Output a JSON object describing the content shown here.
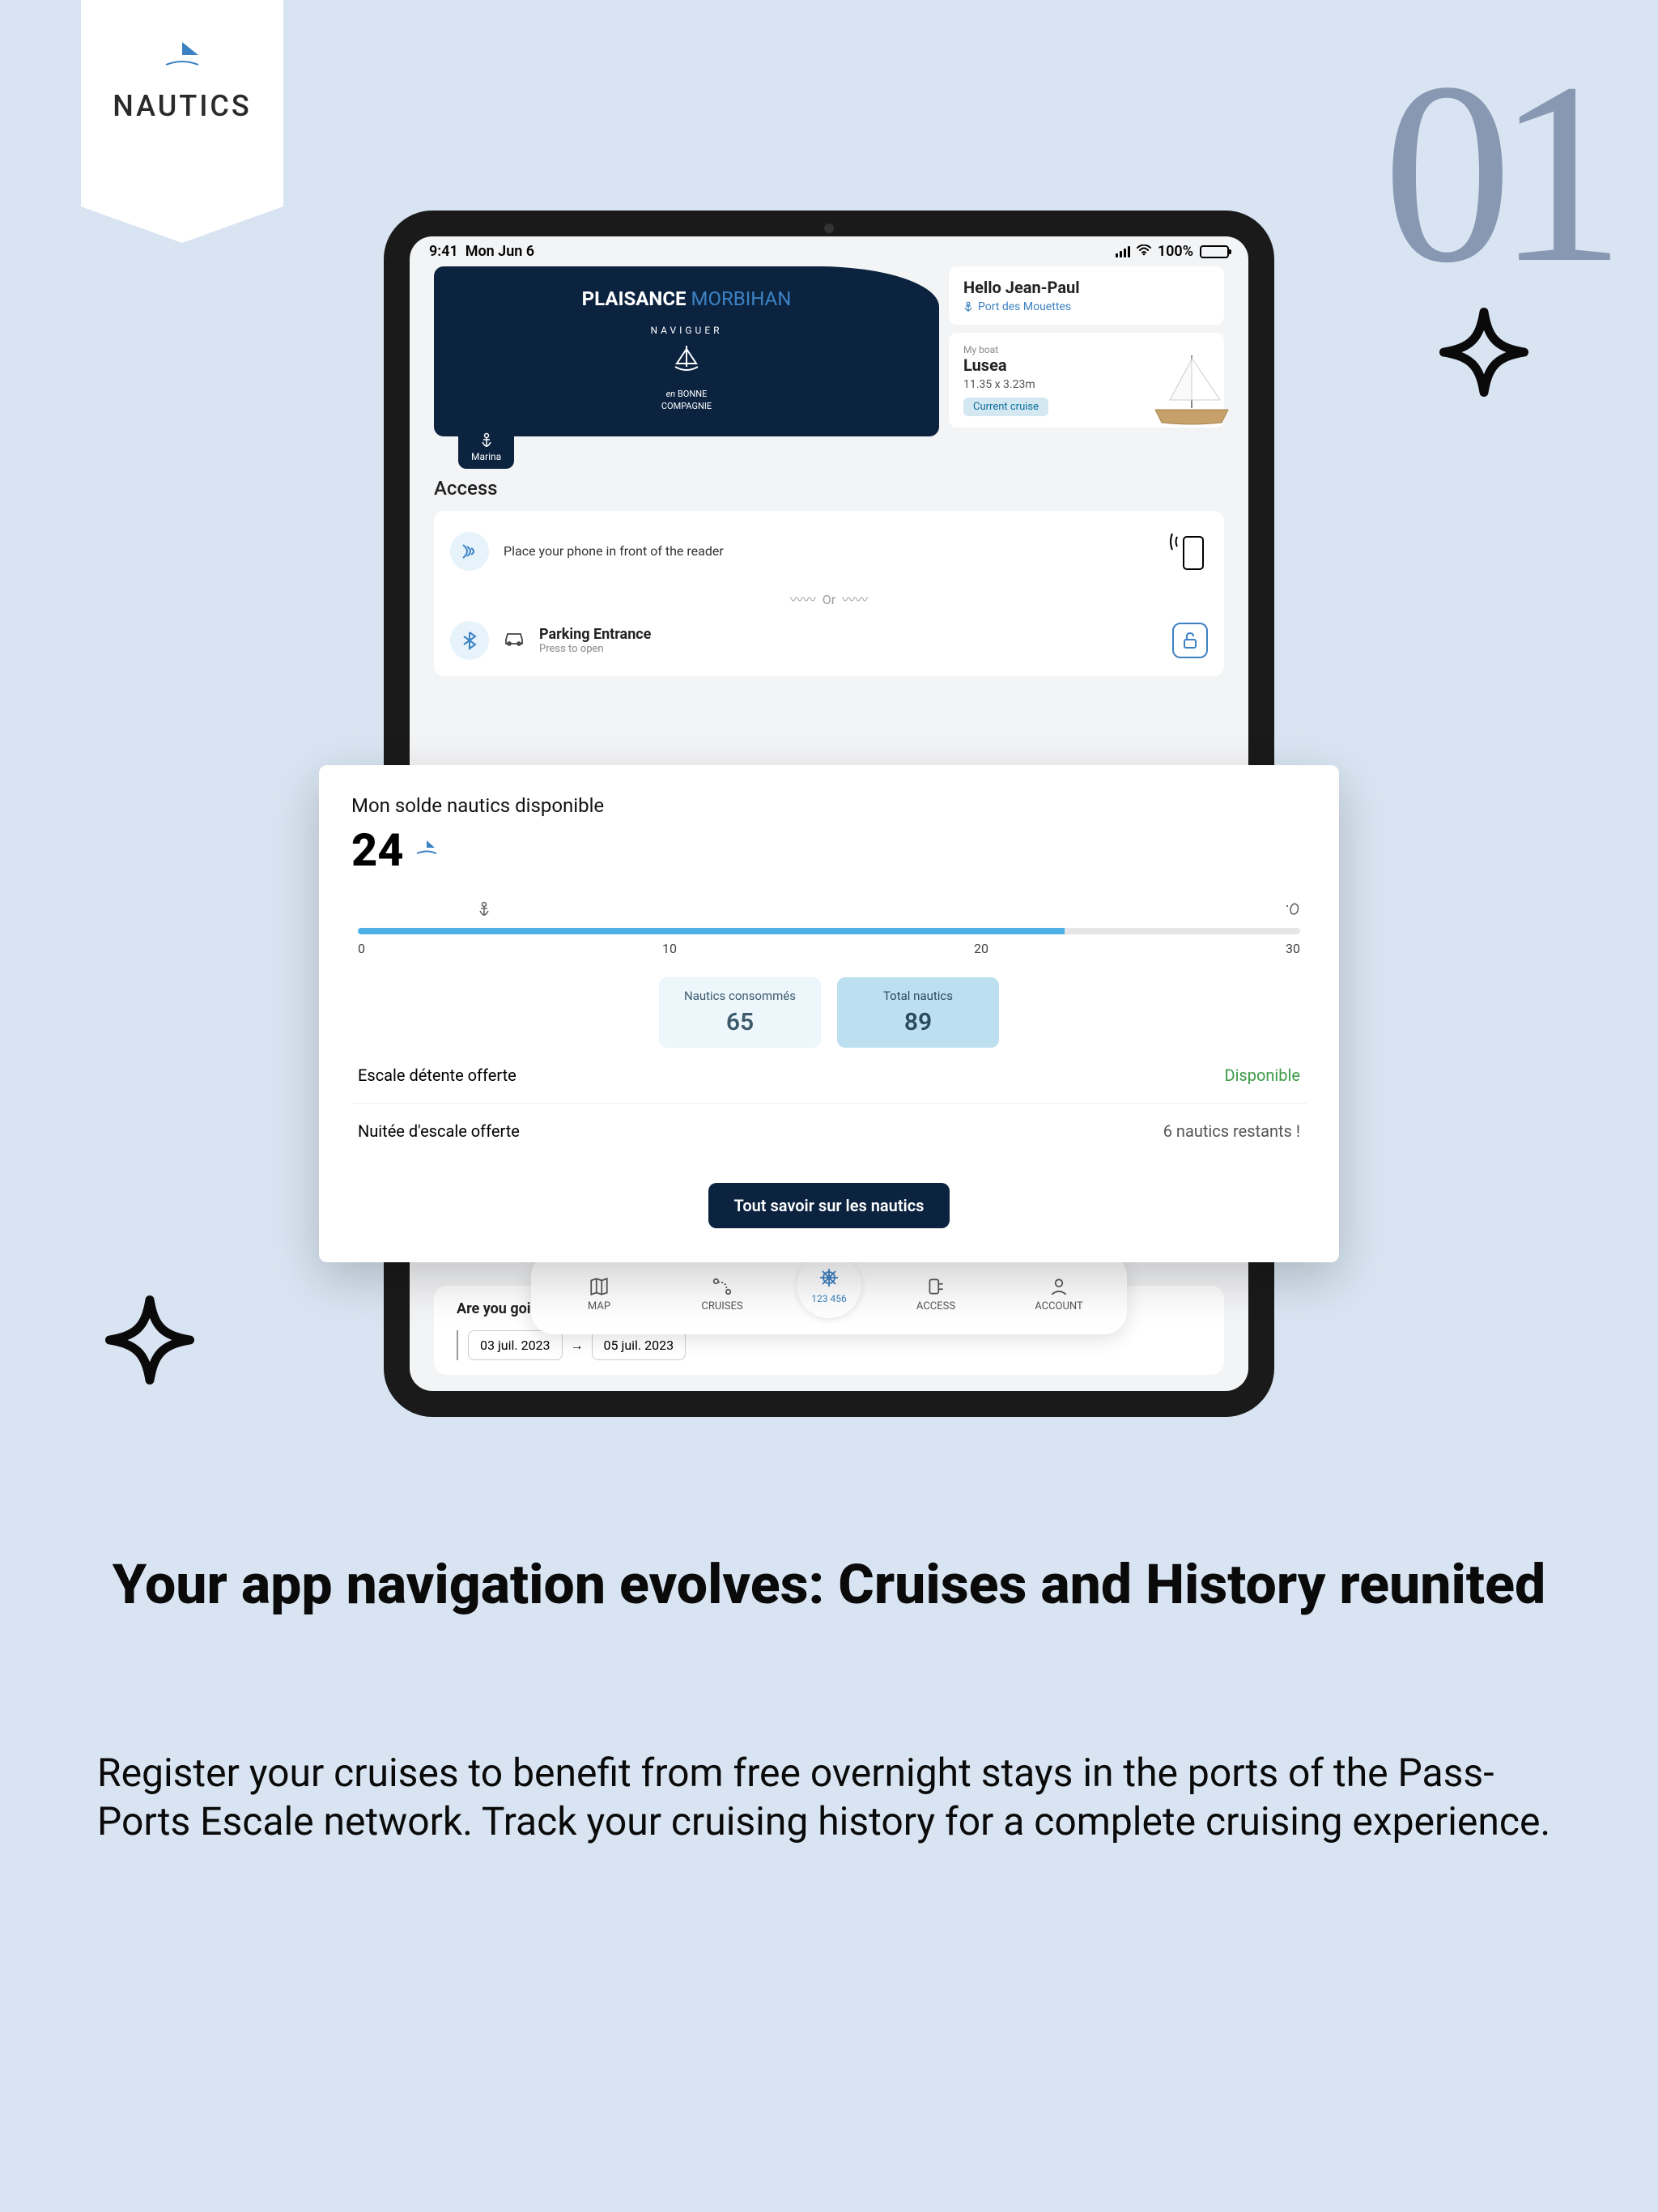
{
  "ribbon": {
    "label": "NAUTICS"
  },
  "page_number": "01",
  "ipad": {
    "status": {
      "time": "9:41",
      "date": "Mon Jun 6",
      "battery": "100%",
      "wifi": "📶"
    },
    "brand": {
      "name": "PLAISANCE",
      "suffix": "MORBIHAN",
      "emblem_top": "NAVIGUER",
      "emblem_bottom_it": "en",
      "emblem_bottom_1": "BONNE",
      "emblem_bottom_2": "COMPAGNIE"
    },
    "greeting": {
      "text": "Hello Jean-Paul",
      "port": "Port des Mouettes"
    },
    "boat": {
      "label": "My boat",
      "name": "Lusea",
      "dimensions": "11.35 x 3.23m",
      "badge": "Current cruise"
    },
    "marina_tab": "Marina",
    "access": {
      "title": "Access",
      "nfc_line": "Place your phone in front of the reader",
      "or": "Or",
      "parking_title": "Parking Entrance",
      "parking_sub": "Press to open"
    },
    "sailing": {
      "question": "Are you going sailing?",
      "date_start": "03 juil. 2023",
      "date_end": "05 juil. 2023"
    },
    "nav": {
      "map": "MAP",
      "cruises": "CRUISES",
      "center": "123 456",
      "access": "ACCESS",
      "account": "ACCOUNT"
    }
  },
  "overlay": {
    "title": "Mon solde nautics disponible",
    "balance": "24",
    "slider": {
      "ticks": [
        "0",
        "10",
        "20",
        "30"
      ]
    },
    "stats": [
      {
        "label": "Nautics consommés",
        "value": "65"
      },
      {
        "label": "Total nautics",
        "value": "89"
      }
    ],
    "offers": [
      {
        "label": "Escale détente offerte",
        "status": "Disponible",
        "kind": "green"
      },
      {
        "label": "Nuitée d'escale offerte",
        "status": "6 nautics restants !",
        "kind": "grey"
      }
    ],
    "cta": "Tout savoir sur les nautics"
  },
  "headline": "Your app navigation evolves: Cruises and History reunited",
  "body": "Register your cruises to benefit from free overnight stays in the ports of the Pass-Ports Escale network. Track your cruising history for a complete cruising experience."
}
